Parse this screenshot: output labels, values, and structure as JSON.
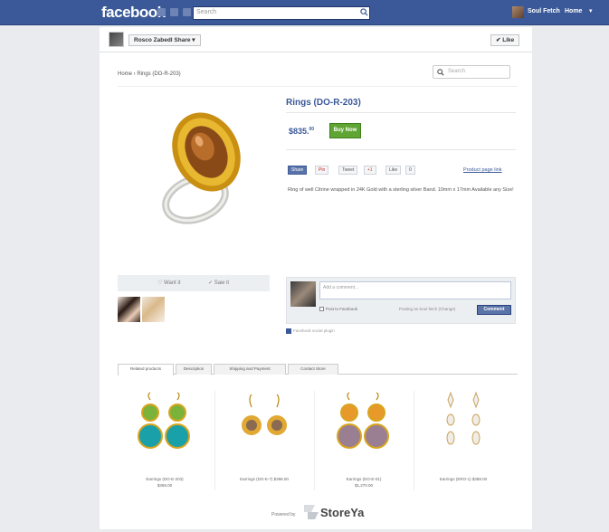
{
  "topbar": {
    "brand": "facebook",
    "search_placeholder": "Search",
    "user_name": "Soul Fetch",
    "home_label": "Home"
  },
  "page_header": {
    "page_name": "Rosco Zabedl  Share",
    "like_label": "Like"
  },
  "store": {
    "breadcrumb": "Home › Rings (DO-R-203)",
    "search_placeholder": "Search",
    "product": {
      "title": "Rings (DO-R-203)",
      "price": "$835.",
      "price_cents": "00",
      "buy_label": "Buy Now",
      "share_buttons": [
        "Share",
        "Pin",
        "Tweet",
        "+1",
        "Like",
        "0"
      ],
      "product_page_link": "Product page link",
      "description": "Ring of well Citrine wrapped in 24K Gold with a sterling silver Band. 10mm x 17mm Available any Size!"
    },
    "image_actions": {
      "want_label": "Want it",
      "saw_label": "Saw it"
    },
    "comments": {
      "placeholder": "Add a comment...",
      "post_to_facebook": "Post to Facebook",
      "posting_as": "Posting as Soul fetch (Change)",
      "comment_button": "Comment",
      "social_plugin": "Facebook social plugin"
    },
    "tabs": [
      "Related products",
      "Description",
      "Shipping and Payment",
      "Contact Store"
    ],
    "related_products": [
      {
        "caption": "Earrings (DO-E-203)",
        "price": "$369.00"
      },
      {
        "caption": "Earrings (DO-E-7)",
        "price": "$398.00"
      },
      {
        "caption": "Earrings (DO-E-01)",
        "price": "$1,270.00"
      },
      {
        "caption": "Earrings (ERO-1)",
        "price": "$388.00"
      }
    ],
    "powered_by": "Powered by",
    "storeya": "StoreYa"
  },
  "colors": {
    "facebook_blue": "#3b5998",
    "buy_green": "#5fa534",
    "gold": "#d9a520",
    "citrine": "#8a4a18"
  }
}
